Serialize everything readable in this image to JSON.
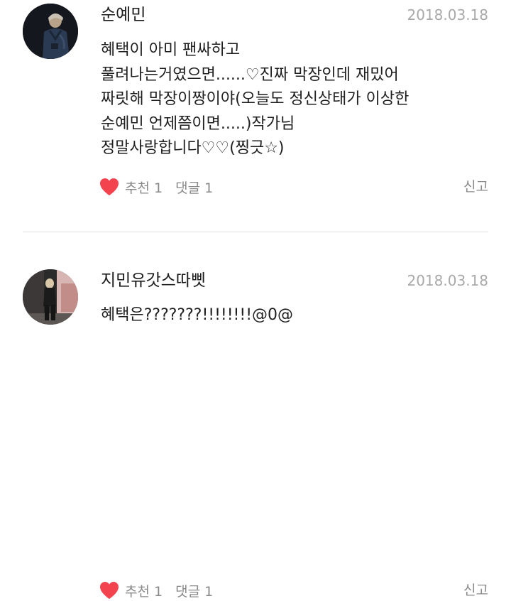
{
  "comments": [
    {
      "author": "순예민",
      "date": "2018.03.18",
      "body_lines": [
        "혜택이 아미 팬싸하고",
        "풀려나는거였으면......♡진짜 막장인데 재밌어",
        "짜릿해 막장이짱이야(오늘도 정신상태가 이상한",
        "순예민 언제쯤이면.....)작가님",
        "정말사랑합니다♡♡(찡긋☆)"
      ],
      "likes_label": "추천 1",
      "replies_label": "댓글 1",
      "report_label": "신고"
    },
    {
      "author": "지민유갓스따삣",
      "date": "2018.03.18",
      "body_lines": [
        "혜택은???????!!!!!!!!@0@"
      ],
      "likes_label": "추천 1",
      "replies_label": "댓글 1",
      "report_label": "신고"
    }
  ],
  "colors": {
    "heart": "#f2434f",
    "meta_text": "#a9a9a9",
    "action_text": "#8a8a8a",
    "divider": "#e3e3e3"
  },
  "icons": {
    "like": "heart-icon"
  }
}
